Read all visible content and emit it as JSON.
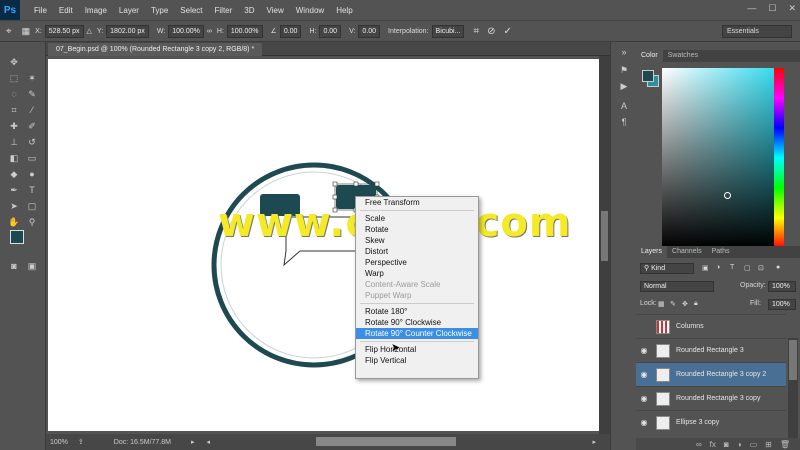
{
  "app": {
    "logo": "Ps"
  },
  "menu": [
    "File",
    "Edit",
    "Image",
    "Layer",
    "Type",
    "Select",
    "Filter",
    "3D",
    "View",
    "Window",
    "Help"
  ],
  "options": {
    "x_label": "X:",
    "x": "528.50 px",
    "y_label": "Y:",
    "y": "1802.00 px",
    "w_label": "W:",
    "w": "100.00%",
    "h_label": "H:",
    "h": "100.00%",
    "angle": "0.00",
    "h_skew_label": "H:",
    "h_skew": "0.00",
    "v_skew_label": "V:",
    "v_skew": "0.00",
    "interpolation_label": "Interpolation:",
    "interpolation": "Bicubi...",
    "workspace": "Essentials"
  },
  "document": {
    "tab": "07_Begin.psd @ 100% (Rounded Rectangle 3 copy 2, RGB/8) *"
  },
  "watermark": "www.cgtsj.com",
  "context_menu": [
    {
      "label": "Free Transform",
      "state": "normal"
    },
    {
      "sep": true
    },
    {
      "label": "Scale",
      "state": "normal"
    },
    {
      "label": "Rotate",
      "state": "normal"
    },
    {
      "label": "Skew",
      "state": "normal"
    },
    {
      "label": "Distort",
      "state": "normal"
    },
    {
      "label": "Perspective",
      "state": "normal"
    },
    {
      "label": "Warp",
      "state": "normal"
    },
    {
      "label": "Content-Aware Scale",
      "state": "disabled"
    },
    {
      "label": "Puppet Warp",
      "state": "disabled"
    },
    {
      "sep": true
    },
    {
      "label": "Rotate 180°",
      "state": "normal"
    },
    {
      "label": "Rotate 90° Clockwise",
      "state": "normal"
    },
    {
      "label": "Rotate 90° Counter Clockwise",
      "state": "highlighted"
    },
    {
      "sep": true
    },
    {
      "label": "Flip Horizontal",
      "state": "normal"
    },
    {
      "label": "Flip Vertical",
      "state": "normal"
    }
  ],
  "status": {
    "zoom": "100%",
    "doc": "Doc: 16.5M/77.8M"
  },
  "color_panel": {
    "tabs": [
      "Color",
      "Swatches"
    ],
    "foreground": "#1d4a50",
    "background": "#2f8fa0"
  },
  "layers_panel": {
    "tabs": [
      "Layers",
      "Channels",
      "Paths"
    ],
    "filter": "Kind",
    "blend_mode": "Normal",
    "opacity_label": "Opacity:",
    "opacity": "100%",
    "lock_label": "Lock:",
    "fill_label": "Fill:",
    "fill": "100%",
    "layers": [
      {
        "name": "Columns",
        "visible": false,
        "selected": false
      },
      {
        "name": "Rounded Rectangle 3",
        "visible": true,
        "selected": false
      },
      {
        "name": "Rounded Rectangle 3 copy 2",
        "visible": true,
        "selected": true
      },
      {
        "name": "Rounded Rectangle 3 copy",
        "visible": true,
        "selected": false
      },
      {
        "name": "Ellipse 3 copy",
        "visible": true,
        "selected": false
      }
    ]
  },
  "colors": {
    "ring": "#1d4a50",
    "accent_highlight": "#3a8ee6"
  }
}
